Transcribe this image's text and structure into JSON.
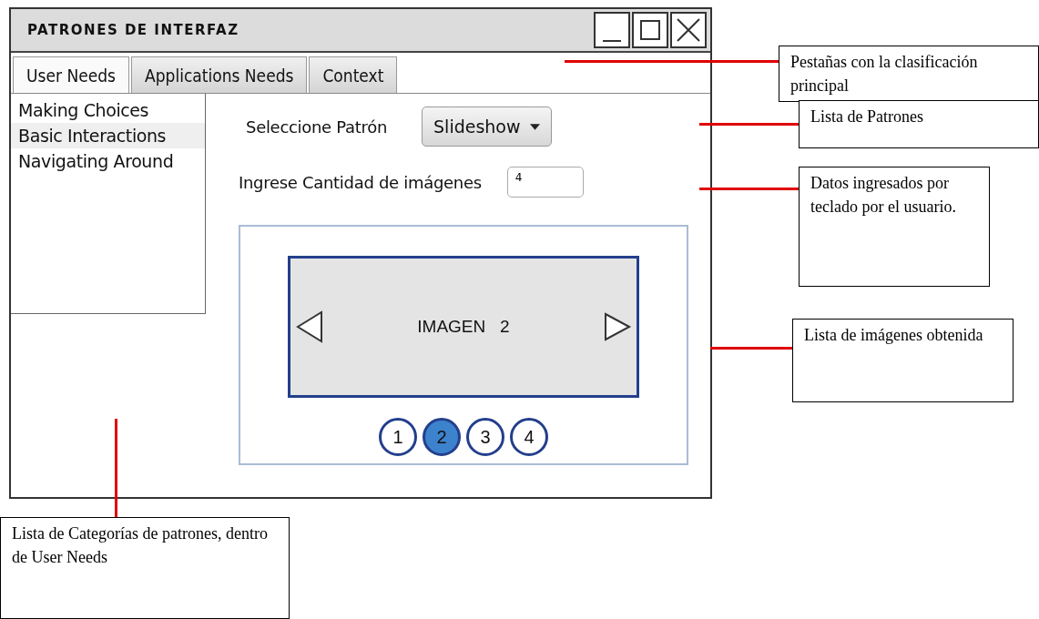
{
  "window": {
    "title": "PATRONES DE INTERFAZ"
  },
  "tabs": [
    {
      "label": "User Needs",
      "selected": true
    },
    {
      "label": "Applications Needs",
      "selected": false
    },
    {
      "label": "Context",
      "selected": false
    }
  ],
  "categories": [
    {
      "label": "Making Choices",
      "selected": false
    },
    {
      "label": "Basic Interactions",
      "selected": true
    },
    {
      "label": "Navigating Around",
      "selected": false
    }
  ],
  "pattern": {
    "label": "Seleccione Patrón",
    "value": "Slideshow"
  },
  "quantity": {
    "label": "Ingrese Cantidad de imágenes",
    "value": "4"
  },
  "slideshow": {
    "image_label": "IMAGEN   2",
    "pages": [
      {
        "label": "1",
        "selected": false
      },
      {
        "label": "2",
        "selected": true
      },
      {
        "label": "3",
        "selected": false
      },
      {
        "label": "4",
        "selected": false
      }
    ]
  },
  "annotations": [
    {
      "text": "Pestañas con la clasificación principal"
    },
    {
      "text": "Lista de Patrones"
    },
    {
      "text": "Datos ingresados por teclado por el usuario."
    },
    {
      "text": "Lista de imágenes obtenida"
    },
    {
      "text": "Lista de Categorías de patrones, dentro de User Needs"
    }
  ]
}
